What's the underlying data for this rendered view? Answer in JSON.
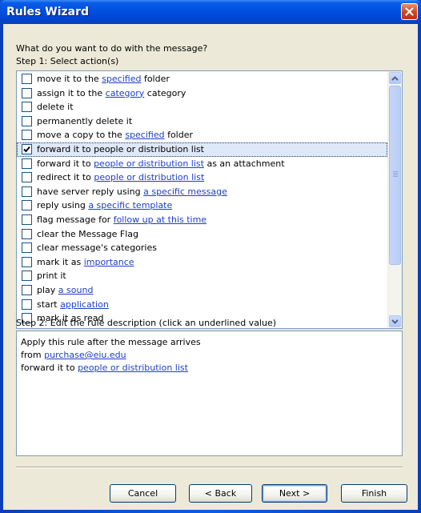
{
  "window": {
    "title": "Rules Wizard"
  },
  "prompt": "What do you want to do with the message?",
  "step1": {
    "label": "Step 1: Select action(s)",
    "actions": [
      {
        "pre": "move it to the ",
        "link": "specified",
        "post": " folder",
        "checked": false
      },
      {
        "pre": "assign it to the ",
        "link": "category",
        "post": " category",
        "checked": false
      },
      {
        "pre": "delete it",
        "link": "",
        "post": "",
        "checked": false
      },
      {
        "pre": "permanently delete it",
        "link": "",
        "post": "",
        "checked": false
      },
      {
        "pre": "move a copy to the ",
        "link": "specified",
        "post": " folder",
        "checked": false
      },
      {
        "pre": "forward it to people or distribution list",
        "link": "",
        "post": "",
        "checked": true,
        "selected": true
      },
      {
        "pre": "forward it to ",
        "link": "people or distribution list",
        "post": " as an attachment",
        "checked": false
      },
      {
        "pre": "redirect it to ",
        "link": "people or distribution list",
        "post": "",
        "checked": false
      },
      {
        "pre": "have server reply using ",
        "link": "a specific message",
        "post": "",
        "checked": false
      },
      {
        "pre": "reply using ",
        "link": "a specific template",
        "post": "",
        "checked": false
      },
      {
        "pre": "flag message for ",
        "link": "follow up at this time",
        "post": "",
        "checked": false
      },
      {
        "pre": "clear the Message Flag",
        "link": "",
        "post": "",
        "checked": false
      },
      {
        "pre": "clear message's categories",
        "link": "",
        "post": "",
        "checked": false
      },
      {
        "pre": "mark it as ",
        "link": "importance",
        "post": "",
        "checked": false
      },
      {
        "pre": "print it",
        "link": "",
        "post": "",
        "checked": false
      },
      {
        "pre": "play ",
        "link": "a sound",
        "post": "",
        "checked": false
      },
      {
        "pre": "start ",
        "link": "application",
        "post": "",
        "checked": false
      },
      {
        "pre": "mark it as read",
        "link": "",
        "post": "",
        "checked": false
      }
    ]
  },
  "step2": {
    "label": "Step 2: Edit the rule description (click an underlined value)",
    "line1": "Apply this rule after the message arrives",
    "line2_pre": "from ",
    "line2_link": "purchase@eiu.edu",
    "line3_pre": "forward it to ",
    "line3_link": "people or distribution list"
  },
  "buttons": {
    "cancel": "Cancel",
    "back": "< Back",
    "next": "Next >",
    "finish": "Finish"
  },
  "colors": {
    "link": "#1e3ec7",
    "title_bar": "#0050e0",
    "dialog_bg": "#ece9d8"
  }
}
